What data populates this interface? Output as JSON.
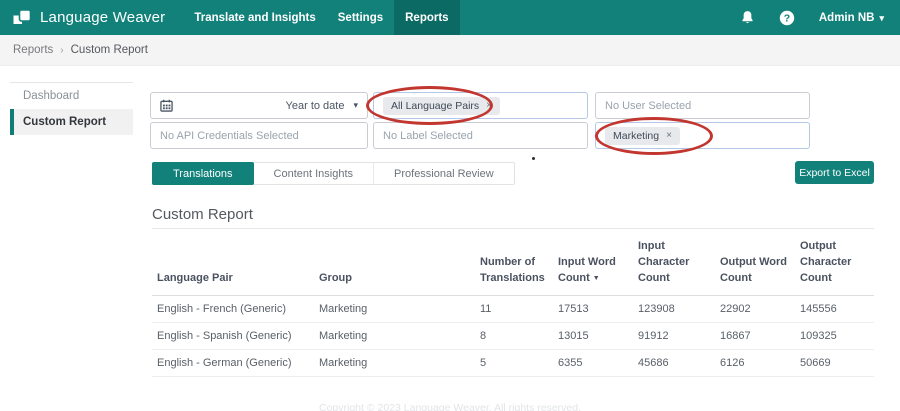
{
  "colors": {
    "brand_teal": "#12817a",
    "brand_teal_dark": "#0b6b64",
    "annotation_red": "#c23630"
  },
  "navbar": {
    "brand": "Language Weaver",
    "items": [
      {
        "label": "Translate and Insights",
        "active": false
      },
      {
        "label": "Settings",
        "active": false
      },
      {
        "label": "Reports",
        "active": true
      }
    ],
    "user_menu": {
      "label": "Admin NB",
      "caret": "▾"
    }
  },
  "breadcrumb": {
    "parent": "Reports",
    "separator": "›",
    "current": "Custom Report"
  },
  "sidebar": {
    "items": [
      {
        "label": "Dashboard",
        "active": false
      },
      {
        "label": "Custom Report",
        "active": true
      }
    ]
  },
  "filters": {
    "date_range": {
      "value": "Year to date",
      "caret": "▾"
    },
    "language_pairs": {
      "tag": "All Language Pairs",
      "remove": "×"
    },
    "user": {
      "placeholder": "No User Selected"
    },
    "api_credentials": {
      "placeholder": "No API Credentials Selected"
    },
    "label": {
      "placeholder": "No Label Selected"
    },
    "group": {
      "tag": "Marketing",
      "remove": "×"
    }
  },
  "tabs": [
    {
      "label": "Translations",
      "active": true
    },
    {
      "label": "Content Insights",
      "active": false
    },
    {
      "label": "Professional Review",
      "active": false
    }
  ],
  "toolbar": {
    "export_label": "Export to Excel"
  },
  "report": {
    "title": "Custom Report",
    "table": {
      "columns": [
        "Language Pair",
        "Group",
        "Number of Translations",
        "Input Word Count",
        "Input Character Count",
        "Output Word Count",
        "Output Character Count"
      ],
      "sort": {
        "column": "Input Word Count",
        "direction": "desc",
        "glyph": "▼"
      },
      "rows": [
        {
          "language_pair": "English - French (Generic)",
          "group": "Marketing",
          "translations": "11",
          "input_word_count": "17513",
          "input_character_count": "123908",
          "output_word_count": "22902",
          "output_character_count": "145556"
        },
        {
          "language_pair": "English - Spanish (Generic)",
          "group": "Marketing",
          "translations": "8",
          "input_word_count": "13015",
          "input_character_count": "91912",
          "output_word_count": "16867",
          "output_character_count": "109325"
        },
        {
          "language_pair": "English - German (Generic)",
          "group": "Marketing",
          "translations": "5",
          "input_word_count": "6355",
          "input_character_count": "45686",
          "output_word_count": "6126",
          "output_character_count": "50669"
        }
      ]
    }
  },
  "footer": {
    "text": "Copyright © 2023 Language Weaver. All rights reserved."
  }
}
